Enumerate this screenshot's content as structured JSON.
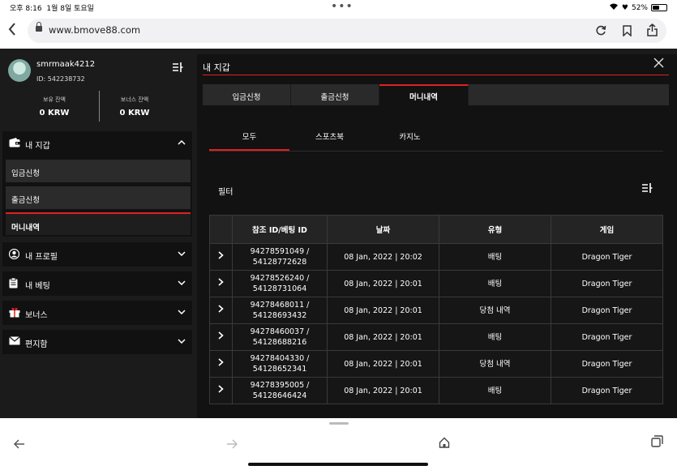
{
  "status_bar": {
    "time": "오후 8:16",
    "date": "1월 8일 토요일",
    "battery": "52%",
    "battery_level": 0.52
  },
  "browser": {
    "url": "www.bmove88.com",
    "icons": [
      "back-icon",
      "lock-icon",
      "reload-icon",
      "bookmark-icon",
      "share-icon"
    ]
  },
  "user": {
    "name": "smrmaak4212",
    "id_text": "ID: 542238732"
  },
  "balances": [
    {
      "label": "보유 잔액",
      "value": "0 KRW"
    },
    {
      "label": "보너스 잔액",
      "value": "0 KRW"
    }
  ],
  "sidebar": {
    "wallet": {
      "label": "내 지갑",
      "items": [
        "입금신청",
        "출금신청",
        "머니내역"
      ]
    },
    "profile": {
      "label": "내 프로필"
    },
    "betting": {
      "label": "내 베팅"
    },
    "bonus": {
      "label": "보너스"
    },
    "mailbox": {
      "label": "편지함"
    }
  },
  "panel": {
    "title": "내 지갑",
    "tabs": [
      "입금신청",
      "출금신청",
      "머니내역"
    ],
    "active_tab": "머니내역",
    "subtabs": [
      "모두",
      "스포츠북",
      "카지노"
    ],
    "active_subtab": "모두",
    "filter_label": "필터"
  },
  "table": {
    "headers": [
      "참조 ID/베팅 ID",
      "날짜",
      "유형",
      "게임"
    ],
    "rows": [
      {
        "ref": "94278591049 /",
        "bet": "54128772628",
        "date": "08 Jan, 2022 | 20:02",
        "type": "배팅",
        "game": "Dragon Tiger"
      },
      {
        "ref": "94278526240 /",
        "bet": "54128731064",
        "date": "08 Jan, 2022 | 20:01",
        "type": "배팅",
        "game": "Dragon Tiger"
      },
      {
        "ref": "94278468011 /",
        "bet": "54128693432",
        "date": "08 Jan, 2022 | 20:01",
        "type": "당첨 내역",
        "game": "Dragon Tiger"
      },
      {
        "ref": "94278460037 /",
        "bet": "54128688216",
        "date": "08 Jan, 2022 | 20:01",
        "type": "배팅",
        "game": "Dragon Tiger"
      },
      {
        "ref": "94278404330 /",
        "bet": "54128652341",
        "date": "08 Jan, 2022 | 20:01",
        "type": "당첨 내역",
        "game": "Dragon Tiger"
      },
      {
        "ref": "94278395005 /",
        "bet": "54128646424",
        "date": "08 Jan, 2022 | 20:01",
        "type": "배팅",
        "game": "Dragon Tiger"
      }
    ]
  },
  "colors": {
    "accent": "#e02020",
    "background": "#1b1b1b",
    "panel": "#121212"
  }
}
